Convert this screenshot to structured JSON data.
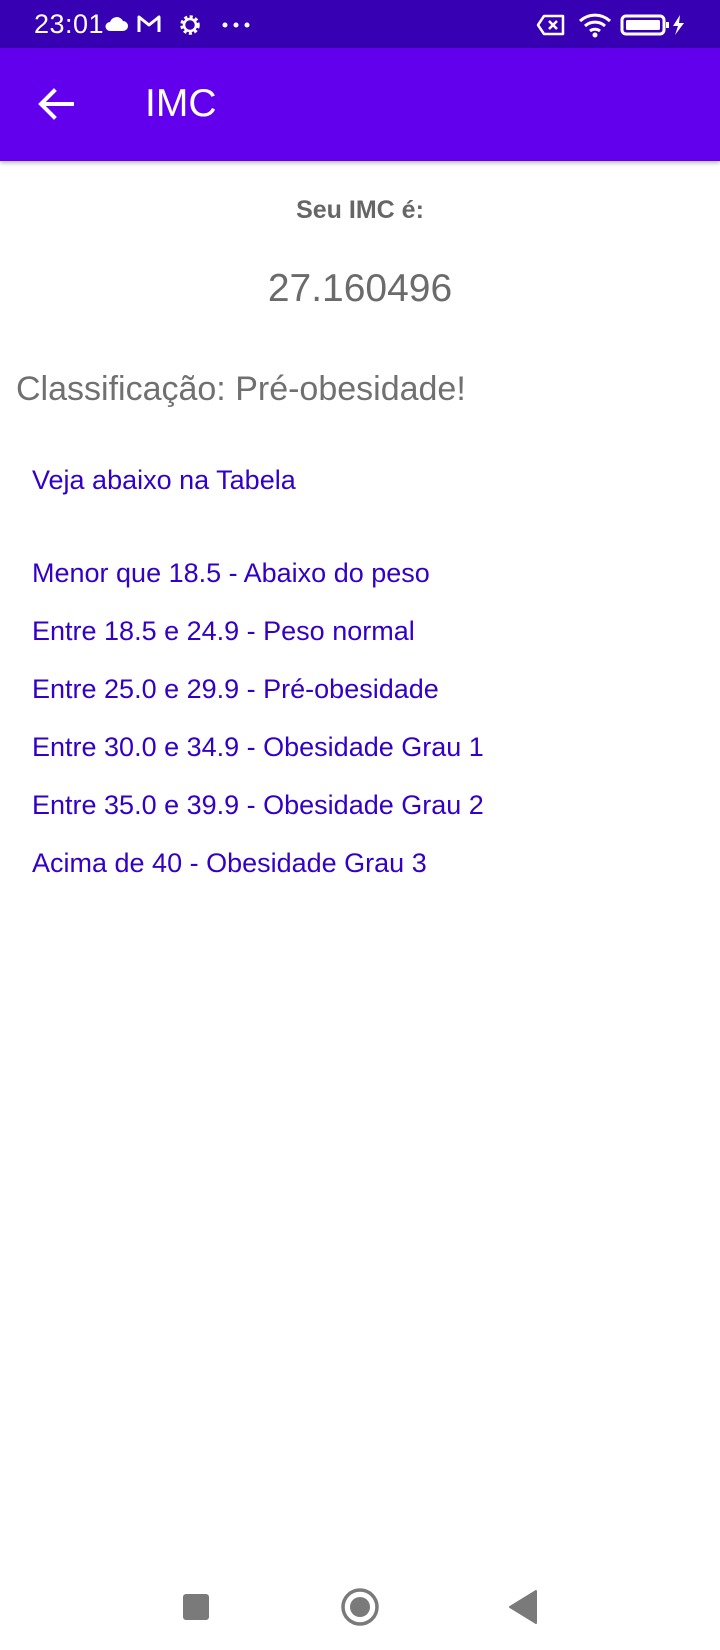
{
  "status_bar": {
    "time": "23:01",
    "left_icons": [
      "cloud-icon",
      "gmail-icon",
      "settings-gear-icon",
      "more-dots-icon"
    ],
    "right_icons": [
      "sim-error-icon",
      "wifi-icon",
      "battery-charging-icon"
    ]
  },
  "app_bar": {
    "title": "IMC",
    "back_icon": "arrow-back-icon",
    "background_color": "#6200ee"
  },
  "result": {
    "label": "Seu IMC é:",
    "value": "27.160496",
    "classification": "Classificação: Pré-obesidade!"
  },
  "table": {
    "intro": "Veja abaixo na Tabela",
    "rows": [
      "Menor que 18.5 - Abaixo do peso",
      "Entre 18.5 e 24.9 - Peso normal",
      "Entre 25.0 e 29.9 - Pré-obesidade",
      "Entre 30.0 e 34.9 - Obesidade Grau 1",
      "Entre 35.0 e 39.9 - Obesidade Grau 2",
      "Acima de 40 - Obesidade Grau 3"
    ],
    "text_color": "#3300c8"
  },
  "nav_bar": {
    "buttons": [
      "recents-square-icon",
      "home-circle-icon",
      "back-triangle-icon"
    ]
  }
}
